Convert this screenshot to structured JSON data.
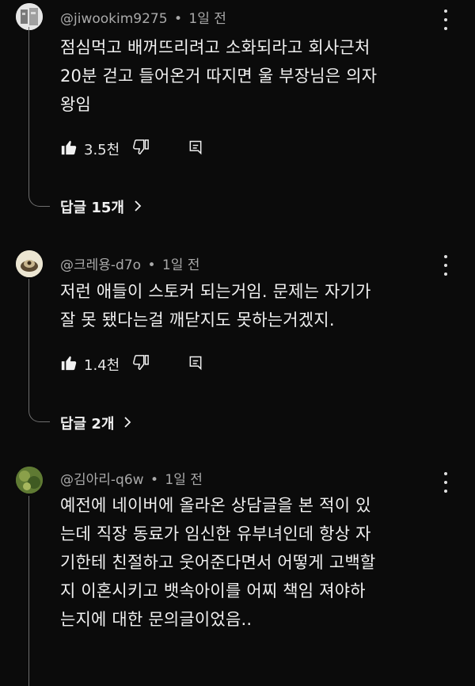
{
  "comments": [
    {
      "handle": "@jiwookim9275",
      "time": "1일 전",
      "lines": [
        "점심먹고 배꺼뜨리려고 소화되라고 회사근처",
        "20분 걷고 들어온거 따지면 울 부장님은 의자",
        "왕임"
      ],
      "likes": "3.5천",
      "replies": "답글 15개"
    },
    {
      "handle": "@크레용-d7o",
      "time": "1일 전",
      "lines": [
        "저런 애들이 스토커 되는거임. 문제는 자기가",
        "잘 못 됐다는걸 깨닫지도 못하는거겠지."
      ],
      "likes": "1.4천",
      "replies": "답글 2개"
    },
    {
      "handle": "@김아리-q6w",
      "time": "1일 전",
      "lines": [
        "예전에 네이버에 올라온 상담글을 본 적이 있",
        "는데 직장 동료가 임신한 유부녀인데 항상 자",
        "기한테 친절하고 웃어준다면서 어떻게 고백할",
        "지 이혼시키고 뱃속아이를 어찌 책임 져야하",
        "는지에 대한 문의글이었음.."
      ]
    }
  ],
  "separator": "•",
  "icons": {
    "like": "thumbs-up-icon",
    "dislike": "thumbs-down-icon",
    "reply": "reply-comment-icon",
    "more": "more-vert-icon",
    "chevron": "chevron-right-icon"
  }
}
